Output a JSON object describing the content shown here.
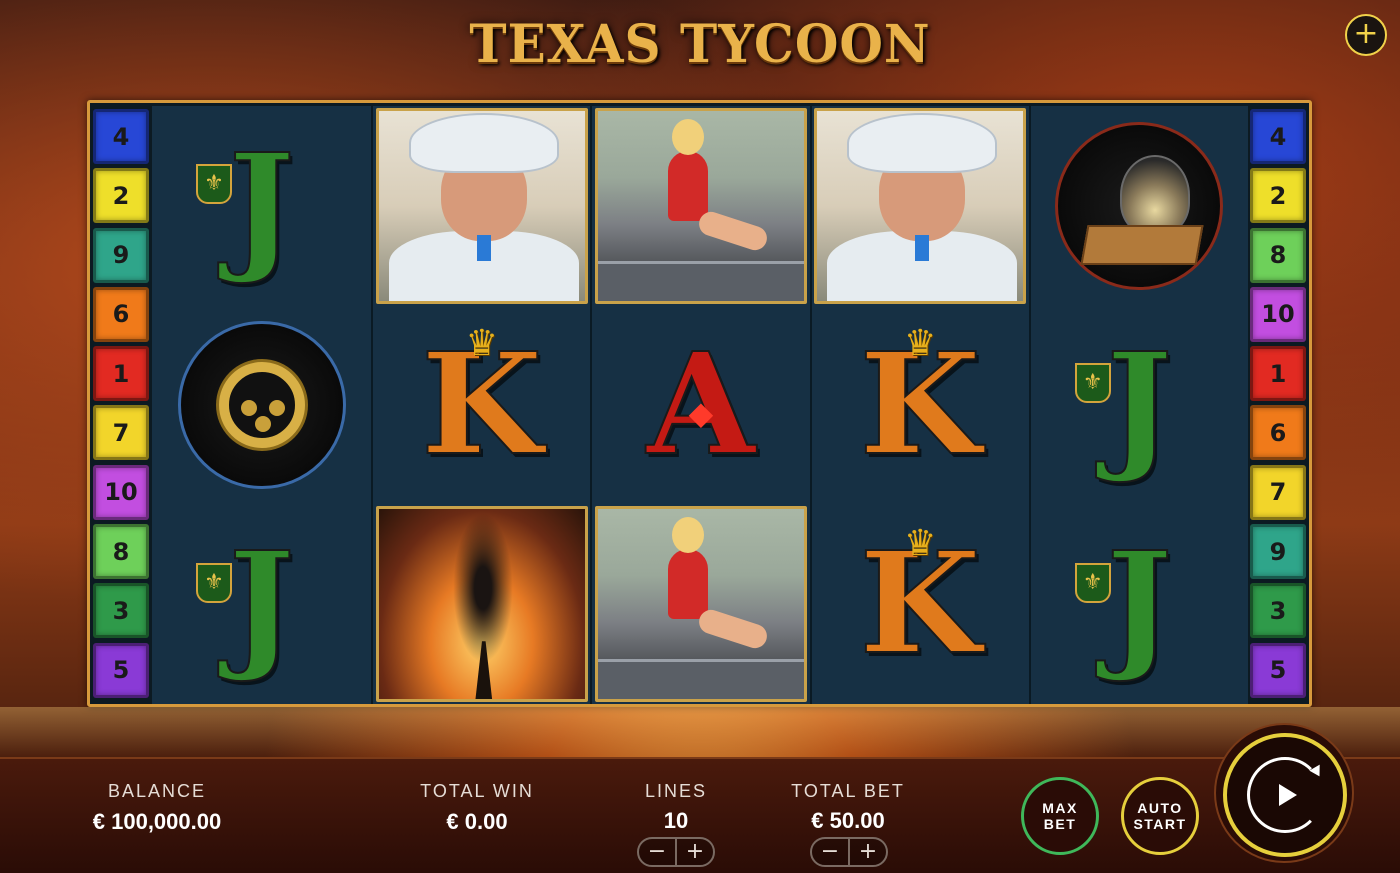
{
  "game_title": "TEXAS TYCOON",
  "menu_icon": "plus-icon",
  "paylines_left": [
    {
      "num": "4",
      "color": "#2747d6"
    },
    {
      "num": "2",
      "color": "#eedf2a"
    },
    {
      "num": "9",
      "color": "#2fa58a"
    },
    {
      "num": "6",
      "color": "#f07a1a"
    },
    {
      "num": "1",
      "color": "#e22a22"
    },
    {
      "num": "7",
      "color": "#f2d52a"
    },
    {
      "num": "10",
      "color": "#c24ee0"
    },
    {
      "num": "8",
      "color": "#6ed05a"
    },
    {
      "num": "3",
      "color": "#2f9a4a"
    },
    {
      "num": "5",
      "color": "#8a3ad6"
    }
  ],
  "paylines_right": [
    {
      "num": "4",
      "color": "#2747d6"
    },
    {
      "num": "2",
      "color": "#eedf2a"
    },
    {
      "num": "8",
      "color": "#6ed05a"
    },
    {
      "num": "10",
      "color": "#c24ee0"
    },
    {
      "num": "1",
      "color": "#e22a22"
    },
    {
      "num": "6",
      "color": "#f07a1a"
    },
    {
      "num": "7",
      "color": "#f2d52a"
    },
    {
      "num": "9",
      "color": "#2fa58a"
    },
    {
      "num": "3",
      "color": "#2f9a4a"
    },
    {
      "num": "5",
      "color": "#8a3ad6"
    }
  ],
  "reels": [
    [
      "J",
      "gold-watch",
      "J"
    ],
    [
      "tycoon",
      "K",
      "oil-gusher"
    ],
    [
      "girl-on-car",
      "A",
      "girl-on-car"
    ],
    [
      "tycoon",
      "K",
      "K"
    ],
    [
      "brandy-cigar",
      "J",
      "J"
    ]
  ],
  "symbol_text": {
    "J": "J",
    "K": "K",
    "A": "A"
  },
  "balance": {
    "label": "BALANCE",
    "value": "€ 100,000.00"
  },
  "total_win": {
    "label": "TOTAL WIN",
    "value": "€ 0.00"
  },
  "lines": {
    "label": "LINES",
    "value": "10",
    "minus": "−",
    "plus": "+"
  },
  "total_bet": {
    "label": "TOTAL BET",
    "value": "€ 50.00",
    "minus": "−",
    "plus": "+"
  },
  "max_bet": {
    "line1": "MAX",
    "line2": "BET"
  },
  "auto_start": {
    "line1": "AUTO",
    "line2": "START"
  },
  "spin_icon": "spin-play-icon"
}
